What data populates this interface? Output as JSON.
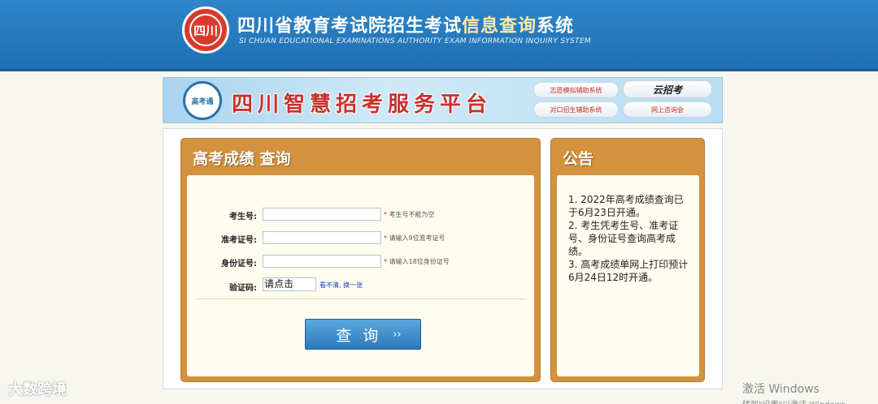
{
  "header": {
    "seal_text": "四川",
    "title_main": "四川省教育考试院招生考试",
    "title_accent": "信息查询",
    "title_tail": "系统",
    "subtitle": "SI CHUAN EDUCATIONAL EXAMINATIONS AUTHORITY EXAM INFORMATION INQUIRY SYSTEM"
  },
  "banner": {
    "logo_text": "高考通",
    "title": "四川智慧招考服务平台",
    "buttons": [
      "志愿模拟辅助系统",
      "对口招生辅助系统",
      "云招考",
      "网上咨询会"
    ]
  },
  "query": {
    "title": "高考成绩  查询",
    "fields": [
      {
        "label": "考生号:",
        "value": "",
        "hint": "考生号不能为空"
      },
      {
        "label": "准考证号:",
        "value": "",
        "hint": "请输入9位准考证号"
      },
      {
        "label": "身份证号:",
        "value": "",
        "hint": "请输入18位身份证号"
      }
    ],
    "captcha_label": "验证码:",
    "captcha_text": "请点击",
    "captcha_refresh": "看不清, 换一张",
    "submit_label": "查询",
    "submit_arrow": "››"
  },
  "notice": {
    "title": "公告",
    "items": [
      "1. 2022年高考成绩查询已于6月23日开通。",
      "2. 考生凭考生号、准考证号、身份证号查询高考成绩。",
      "3. 高考成绩单网上打印预计6月24日12时开通。"
    ]
  },
  "overlay": {
    "watermark": "大数跨境",
    "activate_title": "激活 Windows",
    "activate_sub": "转到\"设置\"以激活 Windows。"
  }
}
